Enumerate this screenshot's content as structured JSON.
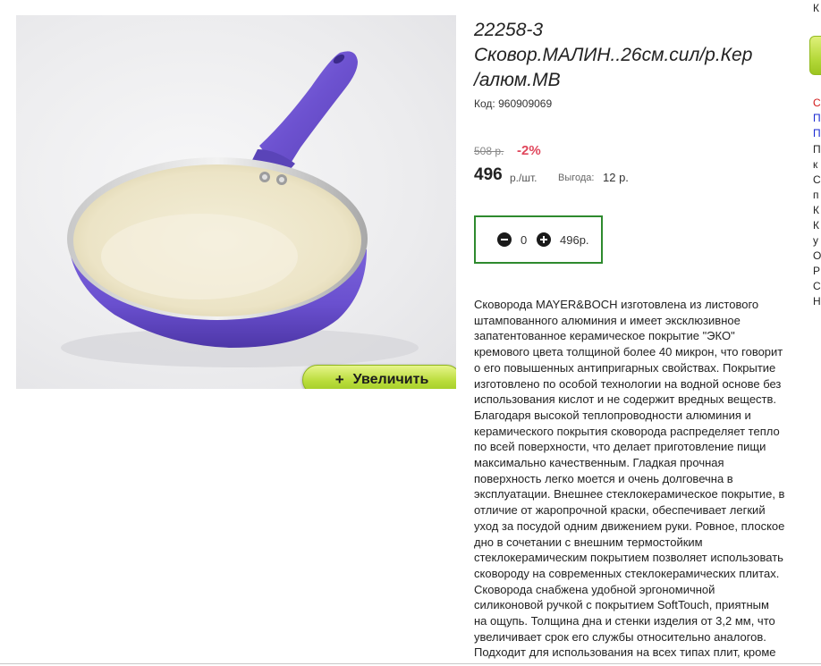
{
  "product": {
    "title_lines": [
      "22258-3",
      "Сковор.МАЛИН..26см.сил/р.Кер",
      "/алюм.MB"
    ],
    "code_label": "Код:",
    "code_value": "960909069",
    "old_price": "508 р.",
    "discount": "-2%",
    "price": "496",
    "price_unit": "р./шт.",
    "savings_label": "Выгода:",
    "savings_value": "12 р.",
    "zoom_button_label": "Увеличить",
    "zoom_button_icon": "+"
  },
  "quantity": {
    "value": "0",
    "total": "496р."
  },
  "description_lines": [
    "Сковорода MAYER&BOCH изготовлена из листового",
    "штампованного алюминия и имеет эксклюзивное",
    "запатентованное керамическое покрытие \"ЭКО\"",
    "кремового цвета толщиной более 40 микрон, что говорит",
    "о его повышенных антипригарных свойствах. Покрытие",
    "изготовлено по особой технологии на водной основе без",
    "использования кислот и не содержит вредных веществ.",
    "Благодаря высокой теплопроводности алюминия и",
    "керамического покрытия сковорода распределяет тепло",
    "по всей поверхности, что делает приготовление пищи",
    "максимально качественным. Гладкая прочная",
    "поверхность легко моется и очень долговечна в",
    "эксплуатации. Внешнее стеклокерамическое покрытие, в",
    "отличие от жаропрочной краски, обеспечивает легкий",
    "уход за посудой одним движением руки. Ровное, плоское",
    "дно в сочетании с внешним термостойким",
    "стеклокерамическим покрытием позволяет использовать",
    "сковороду на современных стеклокерамических плитах.",
    "Сковорода снабжена удобной эргономичной",
    "силиконовой ручкой с покрытием SoftTouch, приятным",
    "на ощупь. Толщина дна и стенки изделия от 3,2 мм, что",
    "увеличивает срок его службы относительно аналогов.",
    "Подходит для использования на всех типах плит, кроме"
  ],
  "right_edge_letters": [
    "К",
    "С",
    "П",
    "П",
    "П",
    "к",
    "С",
    "п",
    "К",
    "К",
    "у",
    "О",
    "Р",
    "С",
    "Н"
  ],
  "colors": {
    "accent_green": "#2e8a2e",
    "discount_red": "#e0475c",
    "button_lime": "#b9dc3a",
    "pan_purple": "#7b63d6",
    "pan_cream": "#efe9cf"
  },
  "icons": {
    "minus": "minus-circle-icon",
    "plus": "plus-circle-icon"
  }
}
